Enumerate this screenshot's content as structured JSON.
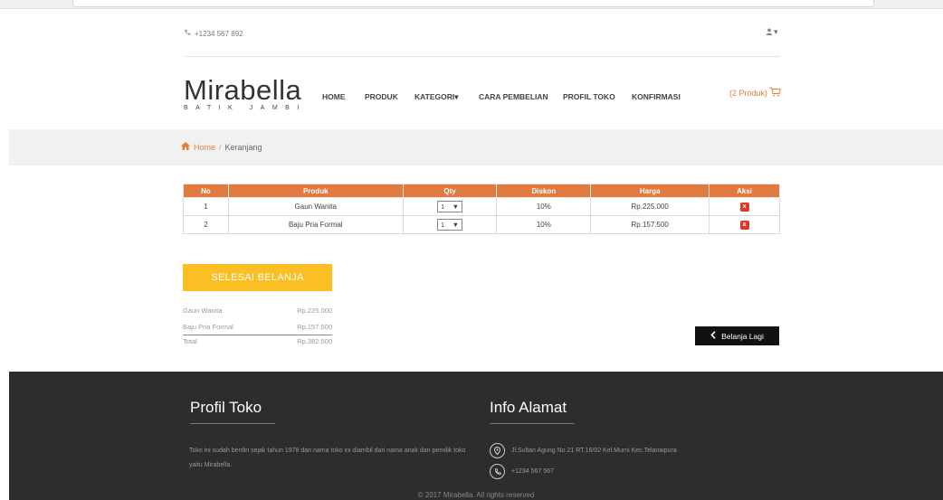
{
  "header": {
    "phone": "+1234 567 892",
    "logo_name": "Mirabella",
    "logo_tag": "BATIK JAMBI",
    "nav": [
      "HOME",
      "PRODUK",
      "KATEGORI",
      "CARA PEMBELIAN",
      "PROFIL TOKO",
      "KONFIRMASI"
    ],
    "cart_label": "(2 Produk)"
  },
  "breadcrumb": {
    "home": "Home",
    "sep": "/",
    "current": "Keranjang"
  },
  "table": {
    "columns": [
      "No",
      "Produk",
      "Qty",
      "Diskon",
      "Harga",
      "Aksi"
    ],
    "rows": [
      {
        "no": "1",
        "produk": "Gaun Wanita",
        "qty": "1",
        "diskon": "10%",
        "harga": "Rp.225.000",
        "aksi": "x"
      },
      {
        "no": "2",
        "produk": "Baju Pria Formal",
        "qty": "1",
        "diskon": "10%",
        "harga": "Rp.157.500",
        "aksi": "x"
      }
    ]
  },
  "checkout": {
    "button": "SELESAI BELANJA",
    "items": [
      {
        "name": "Gaun Wanita",
        "price": "Rp.225.000"
      },
      {
        "name": "Baju Pria Formal",
        "price": "Rp.157.500"
      }
    ],
    "total_label": "Total",
    "total_value": "Rp.382.500"
  },
  "continue_button": "Belanja Lagi",
  "footer": {
    "profile_title": "Profil Toko",
    "profile_text": "Toko ini sudah berdiri sejak tahun 1978 dan nama toko ini diambil dari nama anak dari pemilik toko yaitu Mirabella.",
    "address_title": "Info Alamat",
    "address": "Jl.Sultan Agung No.21 RT.16/02 Kel.Murni Kec.Telanaipura",
    "phone": "+1234 567 567",
    "copyright": "© 2017 Mirabella. All rights reserved"
  },
  "colors": {
    "accent": "#e07a40",
    "button_yellow": "#fbbf24",
    "footer_bg": "#2d2d2d"
  }
}
